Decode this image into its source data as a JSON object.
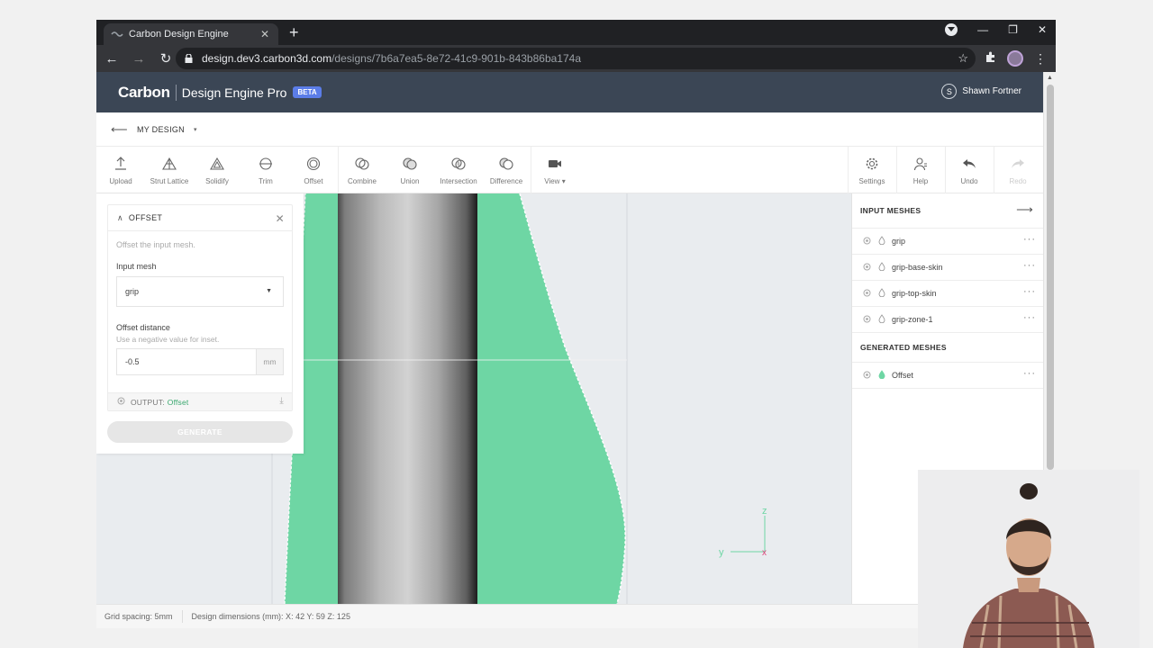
{
  "browser": {
    "tab_title": "Carbon Design Engine",
    "url_host": "design.dev3.carbon3d.com",
    "url_path": "/designs/7b6a7ea5-8e72-41c9-901b-843b86ba174a"
  },
  "header": {
    "brand": "Carbon",
    "product": "Design Engine Pro",
    "badge": "BETA",
    "user_initial": "S",
    "user_name": "Shawn Fortner"
  },
  "subheader": {
    "design_name": "MY DESIGN"
  },
  "toolbar": {
    "upload": "Upload",
    "strut_lattice": "Strut Lattice",
    "solidify": "Solidify",
    "trim": "Trim",
    "offset": "Offset",
    "combine": "Combine",
    "union": "Union",
    "intersection": "Intersection",
    "difference": "Difference",
    "view": "View",
    "settings": "Settings",
    "help": "Help",
    "undo": "Undo",
    "redo": "Redo"
  },
  "offset_panel": {
    "title": "OFFSET",
    "description": "Offset the input mesh.",
    "input_mesh_label": "Input mesh",
    "input_mesh_value": "grip",
    "distance_label": "Offset distance",
    "distance_hint": "Use a negative value for inset.",
    "distance_value": "-0.5",
    "distance_unit": "mm",
    "output_label": "OUTPUT:",
    "output_name": "Offset",
    "generate_label": "GENERATE"
  },
  "meshes": {
    "input_title": "INPUT MESHES",
    "input": [
      "grip",
      "grip-base-skin",
      "grip-top-skin",
      "grip-zone-1"
    ],
    "generated_title": "GENERATED MESHES",
    "generated": [
      "Offset"
    ]
  },
  "axes": {
    "z": "z",
    "y": "y",
    "x": "x"
  },
  "status": {
    "grid": "Grid spacing: 5mm",
    "dimensions": "Design dimensions (mm): X: 42  Y: 59  Z: 125"
  },
  "colors": {
    "mesh_green": "#6ed6a4",
    "header_bg": "#3b4655",
    "beta_badge": "#5b7de8",
    "output_green": "#3aa86f"
  }
}
